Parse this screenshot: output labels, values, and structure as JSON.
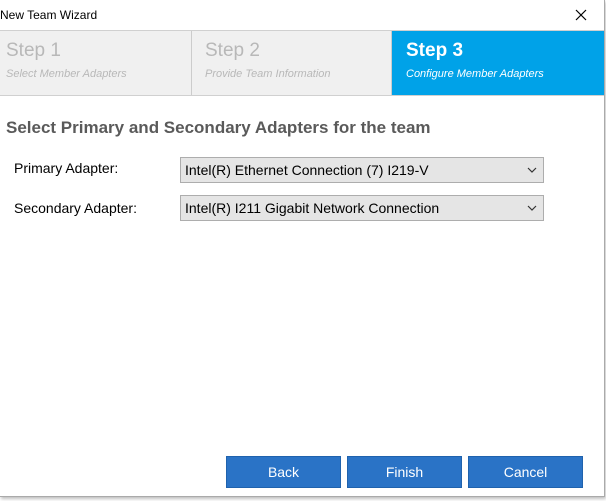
{
  "window": {
    "title": "New Team Wizard",
    "close_icon": "close-icon"
  },
  "steps": [
    {
      "title": "Step 1",
      "subtitle": "Select Member Adapters",
      "active": false
    },
    {
      "title": "Step 2",
      "subtitle": "Provide Team Information",
      "active": false
    },
    {
      "title": "Step 3",
      "subtitle": "Configure Member Adapters",
      "active": true
    }
  ],
  "content": {
    "heading": "Select Primary and Secondary Adapters for the team",
    "primary": {
      "label": "Primary Adapter:",
      "value": "Intel(R) Ethernet Connection (7) I219-V"
    },
    "secondary": {
      "label": "Secondary Adapter:",
      "value": "Intel(R) I211 Gigabit Network Connection"
    }
  },
  "buttons": {
    "back": "Back",
    "finish": "Finish",
    "cancel": "Cancel"
  },
  "colors": {
    "active_step": "#00a2e8",
    "button": "#2a73c6",
    "inactive_step_text": "#b8b8b8"
  }
}
